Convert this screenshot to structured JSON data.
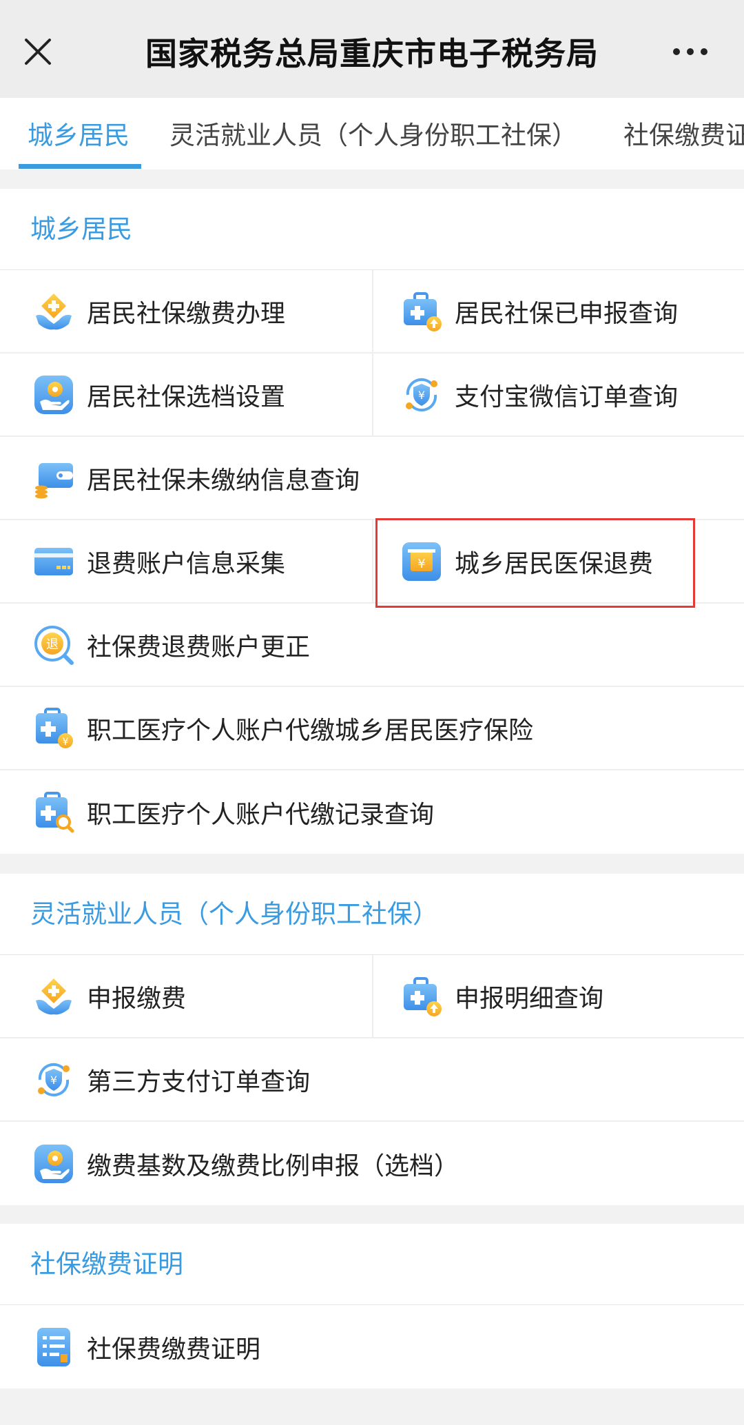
{
  "header": {
    "title": "国家税务总局重庆市电子税务局"
  },
  "tabs": [
    {
      "label": "城乡居民"
    },
    {
      "label": "灵活就业人员（个人身份职工社保）"
    },
    {
      "label": "社保缴费证明"
    }
  ],
  "sections": [
    {
      "title": "城乡居民",
      "items": [
        {
          "label": "居民社保缴费办理",
          "icon": "hand-medical-diamond-icon"
        },
        {
          "label": "居民社保已申报查询",
          "icon": "medical-kit-upload-icon"
        },
        {
          "label": "居民社保选档设置",
          "icon": "hand-coin-settings-icon"
        },
        {
          "label": "支付宝微信订单查询",
          "icon": "yuan-shield-refresh-icon"
        },
        {
          "label": "居民社保未缴纳信息查询",
          "icon": "wallet-coins-icon"
        },
        {
          "label": "退费账户信息采集",
          "icon": "bank-card-icon"
        },
        {
          "label": "城乡居民医保退费",
          "icon": "yuan-refund-box-icon"
        },
        {
          "label": "社保费退费账户更正",
          "icon": "refund-search-icon"
        },
        {
          "label": "职工医疗个人账户代缴城乡居民医疗保险",
          "icon": "clipboard-medical-yuan-icon"
        },
        {
          "label": "职工医疗个人账户代缴记录查询",
          "icon": "clipboard-medical-search-icon"
        }
      ]
    },
    {
      "title": "灵活就业人员（个人身份职工社保）",
      "items": [
        {
          "label": "申报缴费",
          "icon": "hand-medical-diamond-icon"
        },
        {
          "label": "申报明细查询",
          "icon": "medical-kit-upload-icon"
        },
        {
          "label": "第三方支付订单查询",
          "icon": "yuan-shield-refresh-icon"
        },
        {
          "label": "缴费基数及缴费比例申报（选档）",
          "icon": "hand-coin-settings-icon"
        }
      ]
    },
    {
      "title": "社保缴费证明",
      "items": [
        {
          "label": "社保费缴费证明",
          "icon": "document-list-icon"
        }
      ]
    }
  ],
  "refund_label_char": "退",
  "yuan_char": "¥"
}
